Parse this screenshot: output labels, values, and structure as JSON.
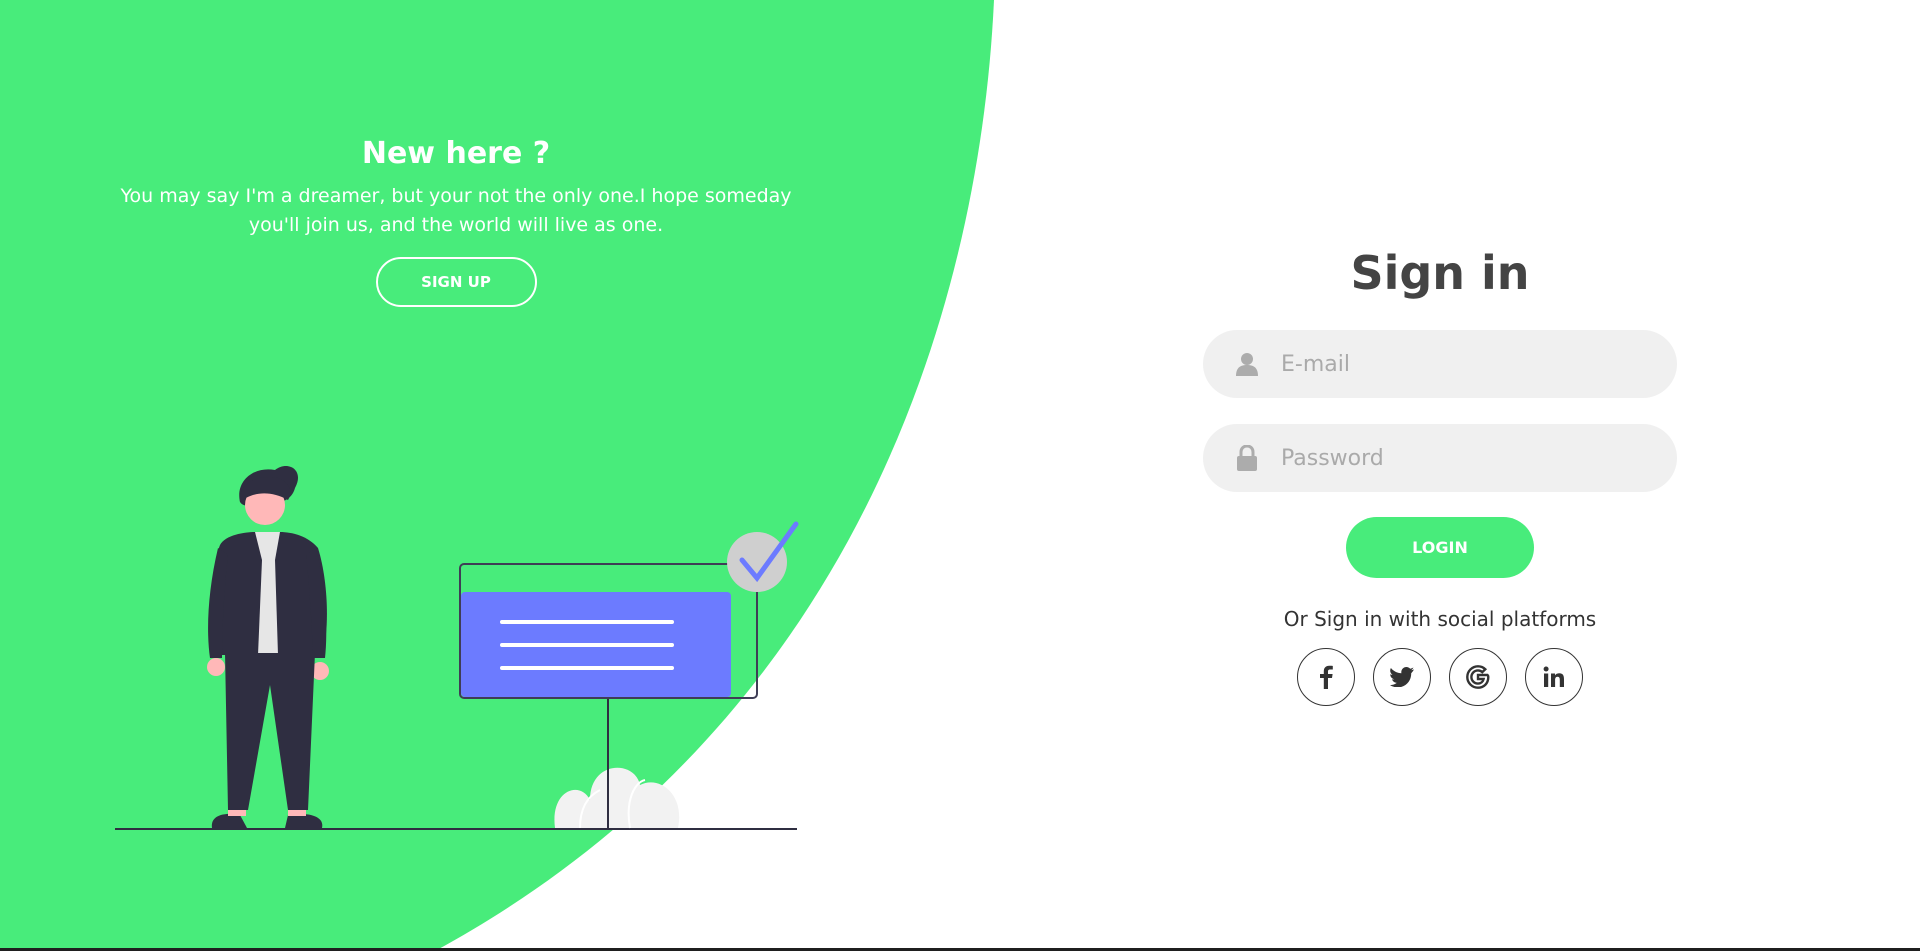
{
  "colors": {
    "accent": "#48ec7b",
    "text_dark": "#444444",
    "input_bg": "#f0f0f0",
    "illustration_dark": "#2f2e41",
    "board_blue": "#6c63ff"
  },
  "left_panel": {
    "title": "New here ?",
    "description": "You may say I'm a dreamer, but your not the only one.I hope someday you'll join us, and the world will live as one.",
    "signup_label": "SIGN UP"
  },
  "signin_form": {
    "title": "Sign in",
    "email_placeholder": "E-mail",
    "email_icon": "user-icon",
    "password_placeholder": "Password",
    "password_icon": "lock-icon",
    "login_label": "LOGIN",
    "social_text": "Or Sign in with social platforms",
    "social": [
      {
        "name": "facebook",
        "icon": "facebook-icon"
      },
      {
        "name": "twitter",
        "icon": "twitter-icon"
      },
      {
        "name": "google",
        "icon": "google-icon"
      },
      {
        "name": "linkedin",
        "icon": "linkedin-icon"
      }
    ]
  }
}
